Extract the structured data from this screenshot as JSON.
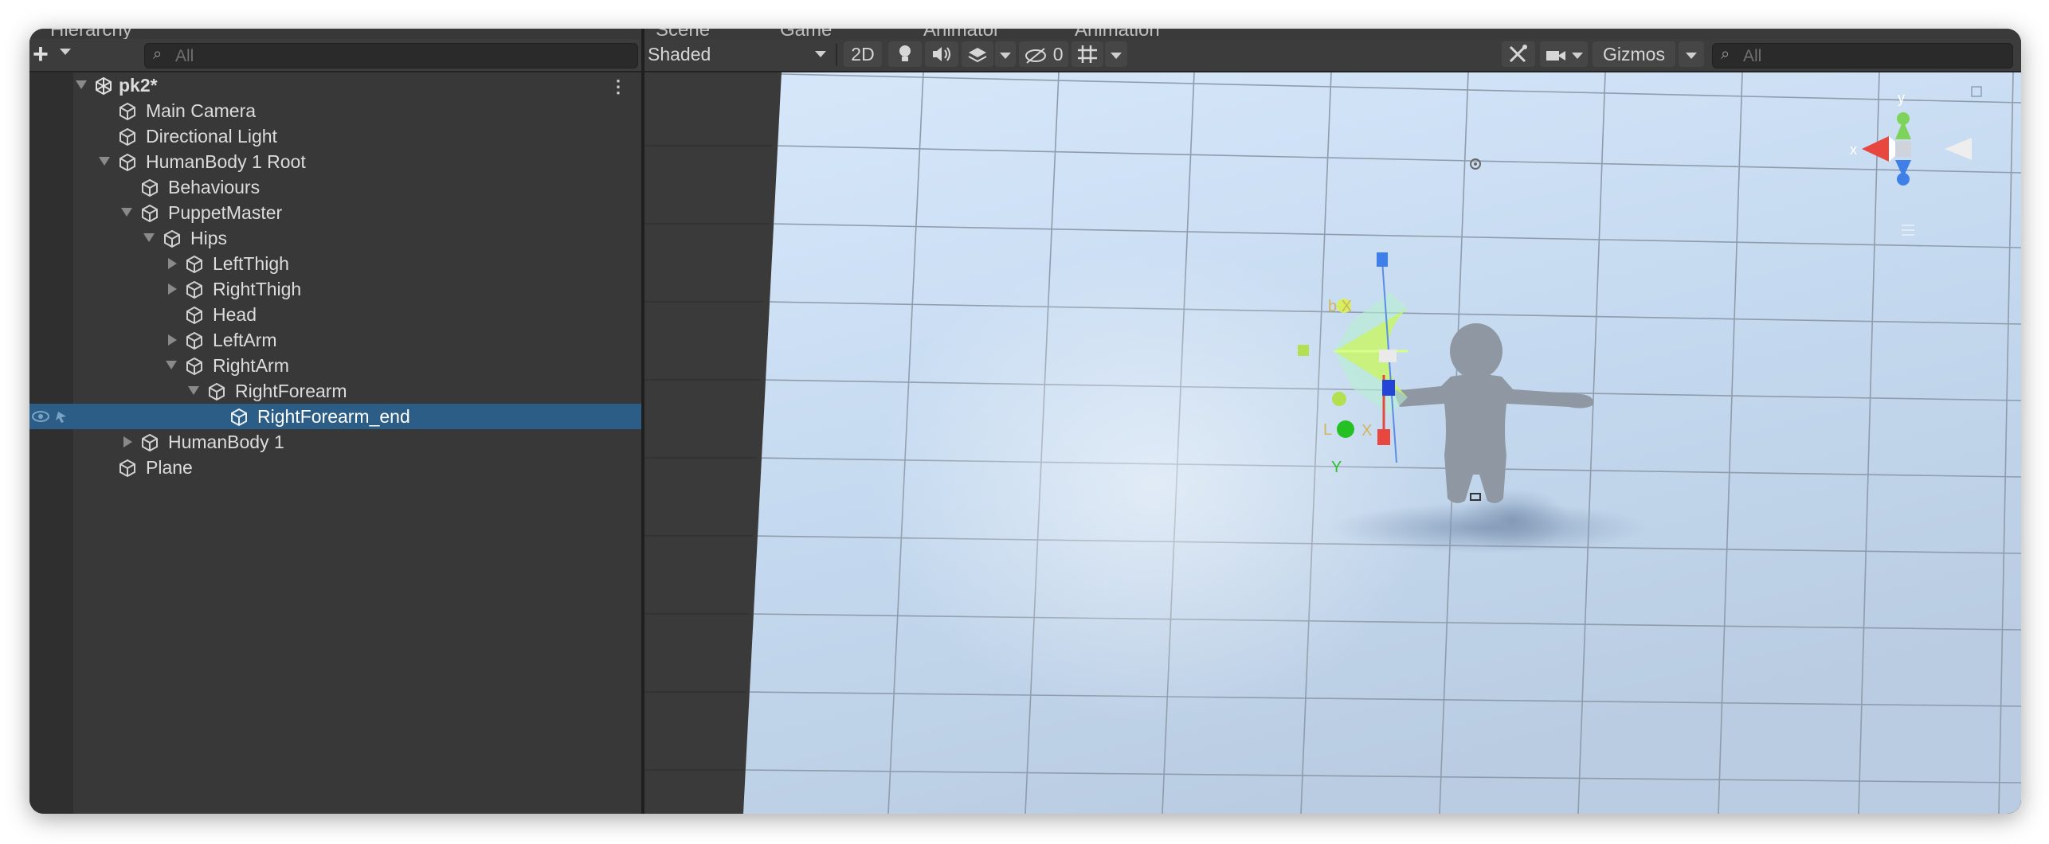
{
  "hierarchy": {
    "tab_label": "Hierarchy",
    "add_label": "+",
    "search_placeholder": "All",
    "scene_name": "pk2*",
    "items": [
      {
        "label": "Main Camera"
      },
      {
        "label": "Directional Light"
      },
      {
        "label": "HumanBody 1 Root"
      },
      {
        "label": "Behaviours"
      },
      {
        "label": "PuppetMaster"
      },
      {
        "label": "Hips"
      },
      {
        "label": "LeftThigh"
      },
      {
        "label": "RightThigh"
      },
      {
        "label": "Head"
      },
      {
        "label": "LeftArm"
      },
      {
        "label": "RightArm"
      },
      {
        "label": "RightForearm"
      },
      {
        "label": "RightForearm_end"
      },
      {
        "label": "HumanBody 1"
      },
      {
        "label": "Plane"
      }
    ]
  },
  "scene_view": {
    "tabs": [
      "Scene",
      "Game",
      "Animator",
      "Animation"
    ],
    "shading_mode": "Shaded",
    "mode_2d": "2D",
    "hidden_count": "0",
    "gizmos_label": "Gizmos",
    "search_placeholder": "All",
    "gizmo_labels": {
      "top": "b X",
      "bottom": "L",
      "bottom_x": "X",
      "y_axis": "Y",
      "orient_y": "y",
      "orient_x": "x"
    }
  },
  "colors": {
    "selection": "#2c5d87",
    "panel": "#383838",
    "ground": "#c7daf0",
    "gizmo_green": "#c8f56a",
    "axis_x": "#e8473f",
    "axis_y": "#7ed35a",
    "axis_z": "#3f7fe8"
  }
}
